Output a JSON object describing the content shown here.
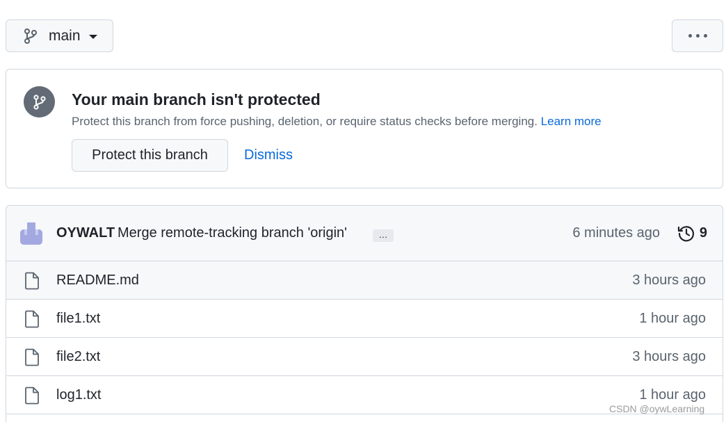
{
  "branch_selector": {
    "label": "main",
    "icon": "git-branch-icon"
  },
  "more_button": {
    "icon": "kebab-horizontal-icon"
  },
  "banner": {
    "title": "Your main branch isn't protected",
    "description": "Protect this branch from force pushing, deletion, or require status checks before merging.",
    "learn_more": "Learn more",
    "protect_button": "Protect this branch",
    "dismiss_button": "Dismiss",
    "icon": "git-branch-icon"
  },
  "latest_commit": {
    "author": "OYWALT",
    "message": "Merge remote-tracking branch 'origin'",
    "ellipsis": "…",
    "time": "6 minutes ago",
    "commit_count": "9",
    "history_icon": "history-icon"
  },
  "files": [
    {
      "name": "README.md",
      "time": "3 hours ago",
      "icon": "file-icon"
    },
    {
      "name": "file1.txt",
      "time": "1 hour ago",
      "icon": "file-icon"
    },
    {
      "name": "file2.txt",
      "time": "3 hours ago",
      "icon": "file-icon"
    },
    {
      "name": "log1.txt",
      "time": "1 hour ago",
      "icon": "file-icon"
    }
  ],
  "watermark": "CSDN @oywLearning",
  "colors": {
    "accent_link": "#0969da",
    "border": "#d0d7de",
    "muted_text": "#59636e",
    "avatar": "#a3a9e0"
  }
}
